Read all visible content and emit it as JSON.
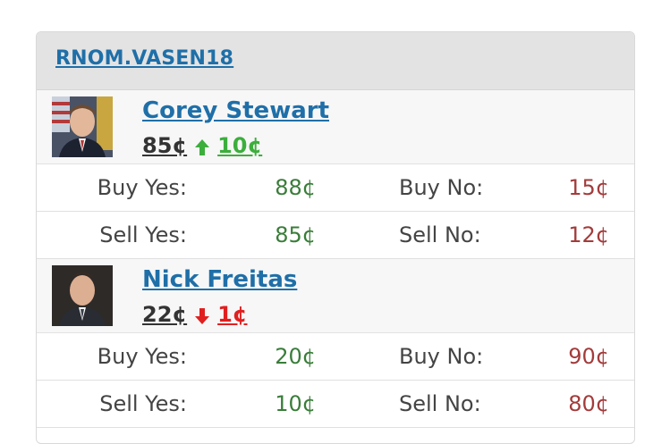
{
  "market": {
    "code": "RNOM.VASEN18"
  },
  "candidates": [
    {
      "name": "Corey Stewart",
      "last_price": "85¢",
      "change": "10¢",
      "direction": "up",
      "buy_yes_label": "Buy Yes:",
      "buy_yes": "88¢",
      "buy_no_label": "Buy No:",
      "buy_no": "15¢",
      "sell_yes_label": "Sell Yes:",
      "sell_yes": "85¢",
      "sell_no_label": "Sell No:",
      "sell_no": "12¢"
    },
    {
      "name": "Nick Freitas",
      "last_price": "22¢",
      "change": "1¢",
      "direction": "down",
      "buy_yes_label": "Buy Yes:",
      "buy_yes": "20¢",
      "buy_no_label": "Buy No:",
      "buy_no": "90¢",
      "sell_yes_label": "Sell Yes:",
      "sell_yes": "10¢",
      "sell_no_label": "Sell No:",
      "sell_no": "80¢"
    }
  ],
  "colors": {
    "link": "#1f6fa8",
    "up": "#3cae3c",
    "down": "#e02020",
    "yes_price": "#3a7d3a",
    "no_price": "#a33b3b",
    "header_bg": "#e3e3e3"
  },
  "icons": {
    "up": "arrow-up-icon",
    "down": "arrow-down-icon"
  }
}
